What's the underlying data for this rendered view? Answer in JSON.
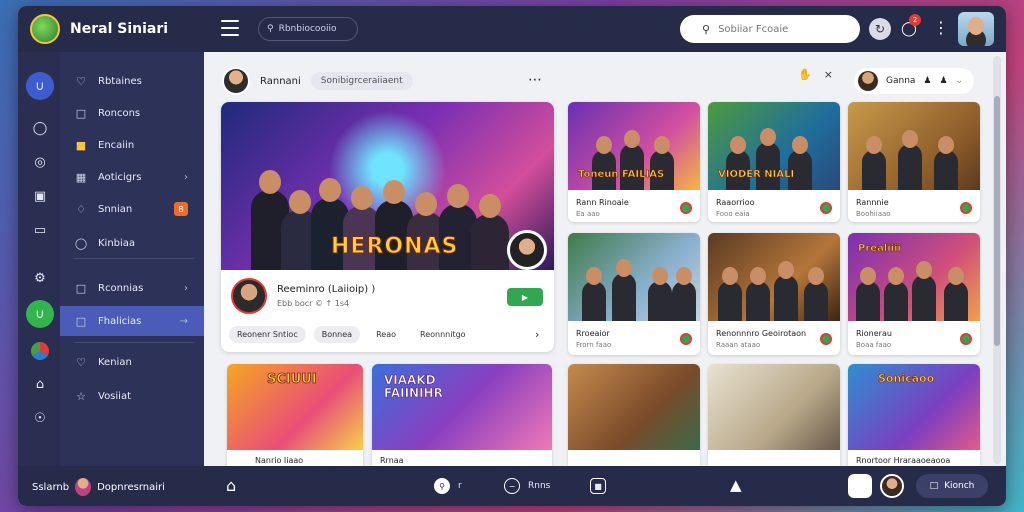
{
  "app": {
    "name": "Neral Siniari"
  },
  "topbar": {
    "chip_search_label": "Rbnbiocooiio",
    "search_placeholder": "Sobiiar Fcoaie",
    "notification_count": "2"
  },
  "sidebar": {
    "items": [
      {
        "label": "Rbtaines",
        "icon": "heart-icon"
      },
      {
        "label": "Roncons",
        "icon": "square-icon"
      },
      {
        "label": "Encaiin",
        "icon": "square-yellow-icon"
      },
      {
        "label": "Aoticigrs",
        "icon": "grid-icon"
      },
      {
        "label": "Snnian",
        "icon": "bell-icon",
        "badge": "B"
      },
      {
        "label": "Kinbiaa",
        "icon": "chat-icon"
      },
      {
        "label": "Rconnias",
        "icon": "square-icon"
      },
      {
        "label": "Fhalicias",
        "icon": "square-icon"
      },
      {
        "label": "Kenian",
        "icon": "heart-icon"
      },
      {
        "label": "Vosiiat",
        "icon": "star-icon"
      }
    ]
  },
  "post": {
    "author": "Rannani",
    "chip": "Sonibigrceraiiaent",
    "user_pill": "Ganna"
  },
  "feature": {
    "title": "HERONAS",
    "name": "Reeminro (Laiioip) )",
    "sub": "Ebb bocr ©   ↑ 1s4",
    "tags": [
      "Reonenr Sntioc",
      "Bonnea",
      "Reao",
      "Reonnnitgo"
    ]
  },
  "cards": [
    {
      "title": "Rann Rinoaie",
      "meta": "Ea aao",
      "thumb_text": "Toneun FAILIAS"
    },
    {
      "title": "Raaorrioo",
      "meta": "Fooo eaia",
      "thumb_text": "VIODER NIALI"
    },
    {
      "title": "Rannnie",
      "meta": "Boohiiaao",
      "thumb_text": ""
    },
    {
      "title": "Rroeaior",
      "meta": "Frorn faao",
      "thumb_text": ""
    },
    {
      "title": "Renonnnro Geoirotaon",
      "meta": "Raaan ataao",
      "thumb_text": ""
    },
    {
      "title": "Rionerau",
      "meta": "Boaa faao",
      "thumb_text": "Prealiiii"
    }
  ],
  "bottom_cards": [
    {
      "label": "Nanrio Iiaao",
      "thumb_text": "SCIUUI"
    },
    {
      "label": "Rrnaa",
      "thumb_text": "VIAAKD FAIINIHR"
    },
    {
      "label": "",
      "thumb_text": ""
    },
    {
      "label": "",
      "thumb_text": ""
    },
    {
      "label": "Rnortoor Hraraaoeaooa",
      "thumb_text": "Sonicaoo"
    }
  ],
  "bottombar": {
    "left_a": "Sslarnb",
    "left_b": "Dopnresrnairi",
    "item1": "r",
    "item2": "Rnns",
    "button": "Kionch"
  }
}
